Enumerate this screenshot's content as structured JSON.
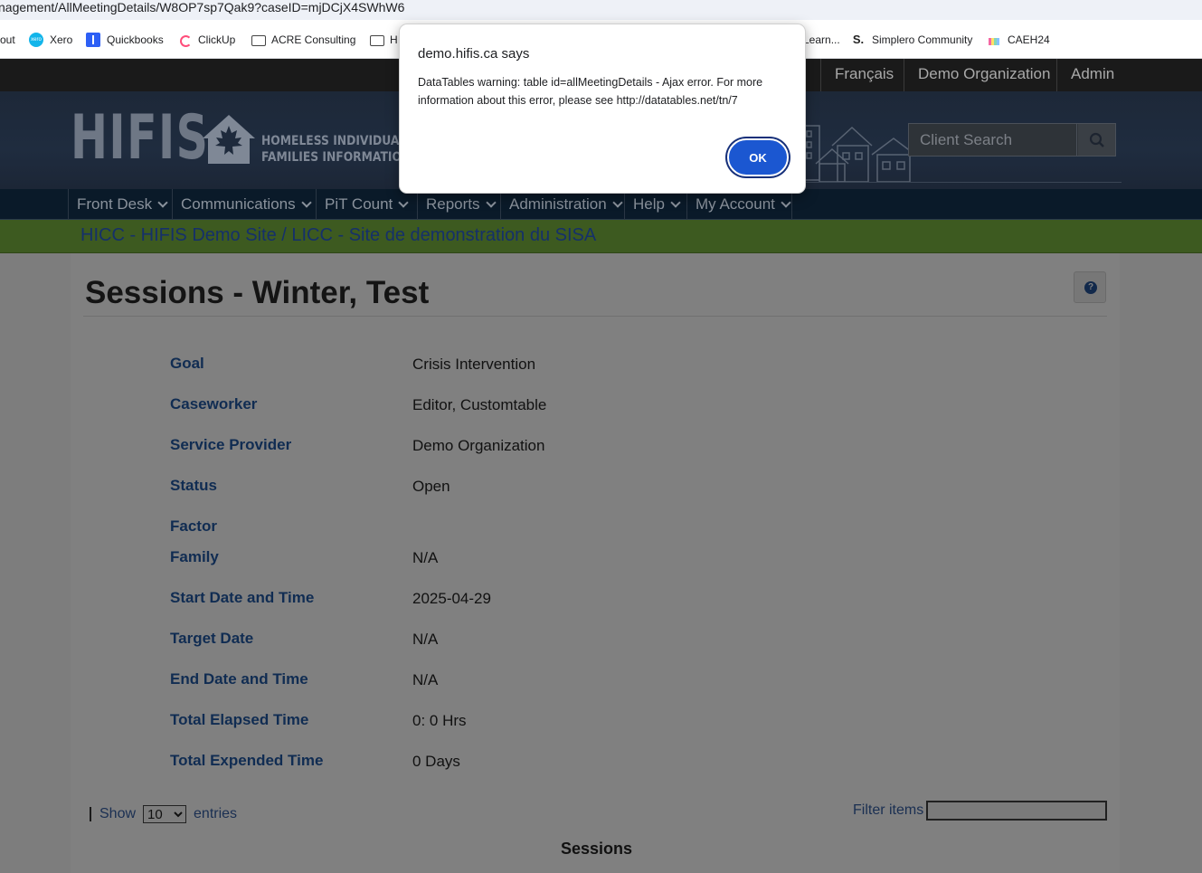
{
  "browser": {
    "url": "nagement/AllMeetingDetails/W8OP7sp7Qak9?caseID=mjDCjX4SWhW6",
    "bookmarks": [
      {
        "label": "out",
        "icon": "none"
      },
      {
        "label": "Xero",
        "icon": "xero-icon"
      },
      {
        "label": "Quickbooks",
        "icon": "quickbooks-icon"
      },
      {
        "label": "ClickUp",
        "icon": "clickup-icon"
      },
      {
        "label": "ACRE Consulting",
        "icon": "folder-icon"
      },
      {
        "label": "H",
        "icon": "folder-icon"
      },
      {
        "label": "Learn...",
        "icon": "none"
      },
      {
        "label": "Simplero Community",
        "icon": "simplero-icon"
      },
      {
        "label": "CAEH24",
        "icon": "caeh-icon"
      }
    ]
  },
  "topbar": {
    "links": [
      "Français",
      "Demo Organization",
      "Admin"
    ]
  },
  "header": {
    "logo_main": "HIFIS",
    "logo_line1": "HOMELESS INDIVIDUALS",
    "logo_line2": "FAMILIES INFORMATION S",
    "search_placeholder": "Client Search"
  },
  "nav": {
    "items": [
      "Front Desk",
      "Communications",
      "PiT Count",
      "Reports",
      "Administration",
      "Help",
      "My Account"
    ]
  },
  "site": {
    "name": "HICC - HIFIS Demo Site / LICC - Site de demonstration du SISA"
  },
  "page": {
    "title": "Sessions - Winter, Test",
    "help_icon": "question-circle-icon"
  },
  "details": [
    {
      "label": "Goal",
      "value": "Crisis Intervention"
    },
    {
      "label": "Caseworker",
      "value": "Editor, Customtable"
    },
    {
      "label": "Service Provider",
      "value": "Demo Organization"
    },
    {
      "label": "Status",
      "value": "Open"
    },
    {
      "label": "Factor",
      "value": ""
    },
    {
      "label": "Family",
      "value": "N/A"
    },
    {
      "label": "Start Date and Time",
      "value": "2025-04-29"
    },
    {
      "label": "Target Date",
      "value": "N/A"
    },
    {
      "label": "End Date and Time",
      "value": "N/A"
    },
    {
      "label": "Total Elapsed Time",
      "value": "0: 0 Hrs"
    },
    {
      "label": "Total Expended Time",
      "value": "0 Days"
    }
  ],
  "table": {
    "show_label": "Show",
    "entries_label": "entries",
    "page_size": "10",
    "filter_label": "Filter items",
    "heading": "Sessions"
  },
  "dialog": {
    "title": "demo.hifis.ca says",
    "message": "DataTables warning: table id=allMeetingDetails - Ajax error. For more information about this error, please see http://datatables.net/tn/7",
    "ok_label": "OK"
  }
}
